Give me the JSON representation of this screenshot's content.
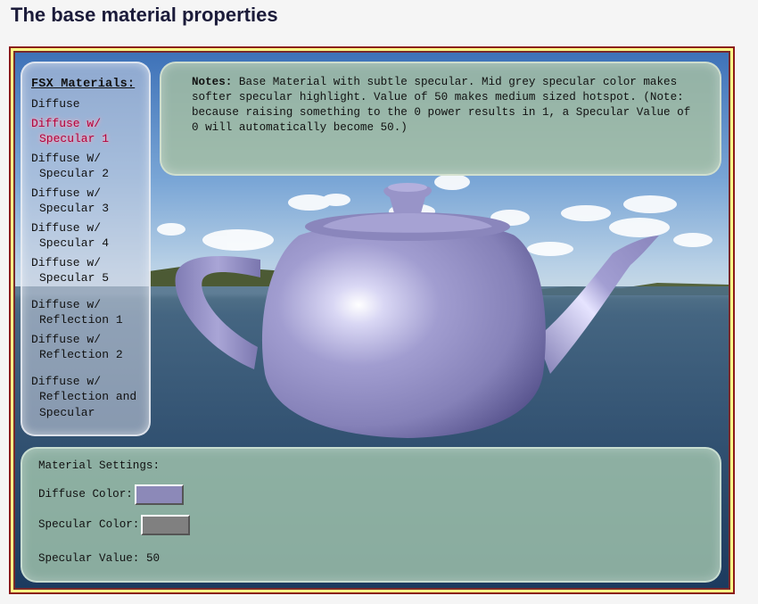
{
  "page": {
    "title": "The base material properties"
  },
  "materials": {
    "title": "FSX Materials:",
    "items": [
      {
        "label": "Diffuse",
        "active": false
      },
      {
        "label": "Diffuse w/\nSpecular 1",
        "active": true
      },
      {
        "label": "Diffuse W/\nSpecular 2",
        "active": false
      },
      {
        "label": "Diffuse w/\nSpecular 3",
        "active": false
      },
      {
        "label": "Diffuse w/\nSpecular 4",
        "active": false
      },
      {
        "label": "Diffuse w/\nSpecular 5",
        "active": false
      },
      {
        "label": "Diffuse w/\nReflection 1",
        "active": false
      },
      {
        "label": "Diffuse w/\nReflection 2",
        "active": false
      },
      {
        "label": "Diffuse w/\nReflection and\nSpecular",
        "active": false
      }
    ]
  },
  "notes": {
    "label": "Notes:",
    "text": "Base Material with subtle specular.  Mid grey specular color makes softer specular highlight.  Value of 50 makes medium sized hotspot. (Note: because raising something to the 0 power results in 1, a Specular Value of 0 will automatically become 50.)"
  },
  "settings": {
    "title": "Material Settings:",
    "diffuse_label": "Diffuse Color:",
    "diffuse_color": "#8c89b8",
    "specular_label": "Specular Color:",
    "specular_color": "#808080",
    "specular_value_label": "Specular Value:",
    "specular_value": "50"
  },
  "colors": {
    "teapot": "#9591c6",
    "active_item": "#b3003a"
  }
}
